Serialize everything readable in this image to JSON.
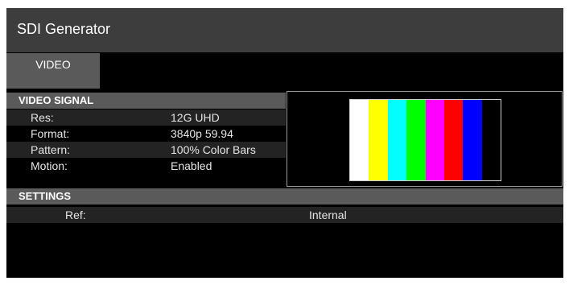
{
  "app": {
    "title": "SDI Generator"
  },
  "tabs": [
    {
      "label": "VIDEO"
    }
  ],
  "video_signal": {
    "header": "VIDEO SIGNAL",
    "rows": [
      {
        "label": "Res:",
        "value": "12G UHD"
      },
      {
        "label": "Format:",
        "value": "3840p 59.94"
      },
      {
        "label": "Pattern:",
        "value": "100% Color Bars"
      },
      {
        "label": "Motion:",
        "value": "Enabled"
      }
    ]
  },
  "settings": {
    "header": "SETTINGS",
    "rows": [
      {
        "label": "Ref:",
        "value": "Internal"
      }
    ]
  },
  "preview": {
    "bars": [
      "#ffffff",
      "#ffff00",
      "#00ffff",
      "#00ff00",
      "#ff00ff",
      "#ff0000",
      "#0000ff",
      "#000000"
    ]
  }
}
